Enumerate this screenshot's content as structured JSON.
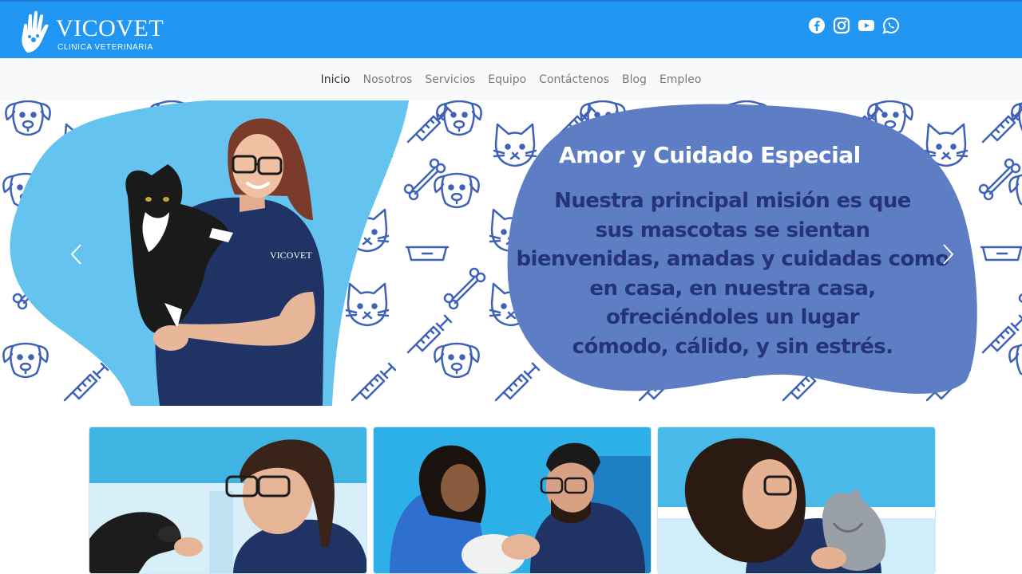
{
  "brand": {
    "name": "VICOVET",
    "subtitle": "CLINICA VETERINARIA",
    "color": "#2196f3"
  },
  "social": [
    "facebook-icon",
    "instagram-icon",
    "youtube-icon",
    "whatsapp-icon"
  ],
  "nav": {
    "items": [
      "Inicio",
      "Nosotros",
      "Servicios",
      "Equipo",
      "Contáctenos",
      "Blog",
      "Empleo"
    ],
    "active": "Inicio"
  },
  "hero": {
    "title": "Amor y Cuidado Especial",
    "lines": [
      "Nuestra principal misión es que",
      "sus mascotas se sientan",
      "bienvenidas, amadas y cuidadas como",
      "en casa, en nuestra casa,",
      "ofreciéndoles un lugar",
      "cómodo, cálido, y sin estrés."
    ],
    "blob_color": "#5d7ec4",
    "shirt_logo": "VICOVET"
  },
  "cards": [
    "card-photo-dog",
    "card-photo-exam",
    "card-photo-cat"
  ]
}
